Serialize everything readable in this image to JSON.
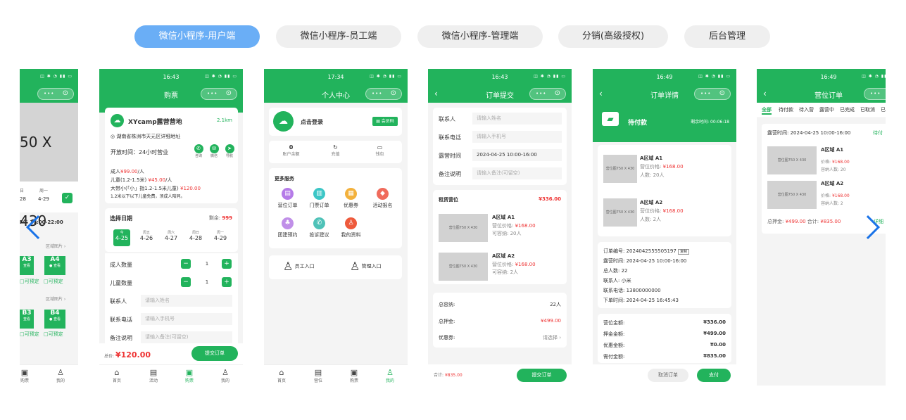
{
  "tabs": [
    "微信小程序-用户端",
    "微信小程序-员工端",
    "微信小程序-管理端",
    "分销(高级授权)",
    "后台管理"
  ],
  "status_icons": "◫ ✱ ◔ ▮▮ ▭",
  "p1": {
    "img": "50 X 430",
    "days": [
      {
        "w": "日",
        "d": "28"
      },
      {
        "w": "周一",
        "d": "4-29"
      }
    ],
    "hours": "F午 17:00-22:00",
    "region": "区域图片 ›",
    "zones": [
      {
        "n": "A3",
        "s": "查看",
        "a": "可预定"
      },
      {
        "n": "A4",
        "s": "● 查看",
        "a": "可预定"
      },
      {
        "n": "B3",
        "s": "查看",
        "a": "可预定"
      },
      {
        "n": "B4",
        "s": "● 查看",
        "a": "可预定"
      }
    ],
    "tabbar": [
      {
        "icon": "▣",
        "label": "购票"
      },
      {
        "icon": "♙",
        "label": "我的"
      }
    ]
  },
  "p2": {
    "title": "购票",
    "camp": "XYcamp露营营地",
    "dist": "2.1km",
    "addr": "◎ 湖南省株洲市天元区详细地址",
    "open": "开放时间：24小时营业",
    "actions": [
      {
        "icon": "✆",
        "label": "咨询"
      },
      {
        "icon": "✉",
        "label": "微信"
      },
      {
        "icon": "➤",
        "label": "导航"
      }
    ],
    "p_adult": "成人",
    "p_adult_price": "¥99.00",
    "p_adult_unit": "/人",
    "p_child": "儿童(1.2-1.5米) ",
    "p_child_price": "¥45.00",
    "p_child_unit": "/人",
    "p_family": "大带小(「小」指1.2-1.5米儿童) ",
    "p_family_price": "¥120.00",
    "p_note": "1.2米以下以下儿童免费，须成人陪同。",
    "date_title": "选择日期",
    "remain_label": "剩余: ",
    "remain": "999",
    "dates": [
      {
        "w": "今",
        "d": "4-25"
      },
      {
        "w": "周五",
        "d": "4-26"
      },
      {
        "w": "周六",
        "d": "4-27"
      },
      {
        "w": "周日",
        "d": "4-28"
      },
      {
        "w": "周一",
        "d": "4-29"
      }
    ],
    "adult_label": "成人数量",
    "child_label": "儿童数量",
    "qty": "1",
    "minus": "−",
    "plus": "+",
    "contact_label": "联系人",
    "contact_ph": "请输入姓名",
    "phone_label": "联系电话",
    "phone_ph": "请输入手机号",
    "remark_label": "备注说明",
    "remark_ph": "请输入备注(可留空)",
    "total_label": "总价: ",
    "total": "¥120.00",
    "submit": "提交订单",
    "tabbar": [
      {
        "icon": "⌂",
        "label": "首页"
      },
      {
        "icon": "▤",
        "label": "活动"
      },
      {
        "icon": "▣",
        "label": "购票"
      },
      {
        "icon": "♙",
        "label": "我的"
      }
    ]
  },
  "p3": {
    "time": "17:34",
    "title": "个人中心",
    "login": "点击登录",
    "member": "▤ 会员码",
    "stats": [
      {
        "v": "0",
        "l": "账户余额"
      },
      {
        "v": "↻",
        "l": "充值"
      },
      {
        "v": "▭",
        "l": "钱包"
      }
    ],
    "more": "更多服务",
    "services": [
      {
        "icon": "▤",
        "label": "营位订单",
        "c": "#b57be8"
      },
      {
        "icon": "▥",
        "label": "门票订单",
        "c": "#3cc6c6"
      },
      {
        "icon": "▦",
        "label": "优惠券",
        "c": "#f3b13c"
      },
      {
        "icon": "◆",
        "label": "活动报名",
        "c": "#f06b5c"
      },
      {
        "icon": "♣",
        "label": "团建预约",
        "c": "#c08fe8"
      },
      {
        "icon": "✆",
        "label": "投诉建议",
        "c": "#4fc2b8"
      },
      {
        "icon": "♙",
        "label": "我的资料",
        "c": "#ee5a3c"
      }
    ],
    "staff": "员工入口",
    "admin": "管理入口",
    "tabbar": [
      {
        "icon": "⌂",
        "label": "首页"
      },
      {
        "icon": "▤",
        "label": "营位"
      },
      {
        "icon": "▣",
        "label": "购票"
      },
      {
        "icon": "♙",
        "label": "我的"
      }
    ]
  },
  "p4": {
    "title": "订单提交",
    "fields": [
      {
        "l": "联系人",
        "v": "请输入姓名"
      },
      {
        "l": "联系电话",
        "v": "请输入手机号"
      },
      {
        "l": "露营时间",
        "v": "2024-04-25 10:00-16:00"
      },
      {
        "l": "备注说明",
        "v": "请输入备注(可留空)"
      }
    ],
    "rent": "租赁营位",
    "rent_total": "¥336.00",
    "items": [
      {
        "img": "营位图750 X 430",
        "name": "A区域 A1",
        "price_l": "营位价格: ",
        "price": "¥168.00",
        "cap": "可容纳: 20人"
      },
      {
        "img": "营位图750 X 430",
        "name": "A区域 A2",
        "price_l": "营位价格: ",
        "price": "¥168.00",
        "cap": "可容纳: 2人"
      }
    ],
    "sum": [
      {
        "l": "总容纳:",
        "v": "22人"
      },
      {
        "l": "总押金:",
        "v": "¥499.00"
      },
      {
        "l": "优惠券:",
        "v": "请选择 ›"
      }
    ],
    "total_label": "合计: ",
    "total": "¥835.00",
    "submit": "提交订单"
  },
  "p5": {
    "time": "16:49",
    "title": "订单详情",
    "status": "待付款",
    "remain": "剩余时间: 00:06:18",
    "items": [
      {
        "img": "营位图750 X 430",
        "name": "A区域 A1",
        "price_l": "营位价格: ",
        "price": "¥168.00",
        "ppl": "人数: 20人"
      },
      {
        "img": "营位图750 X 430",
        "name": "A区域 A2",
        "price_l": "营位价格: ",
        "price": "¥168.00",
        "ppl": "人数: 2人"
      }
    ],
    "order_no": "订单编号: 2024042555505197",
    "copy": "复制",
    "info": [
      "露营时间: 2024-04-25 10:00-16:00",
      "总人数: 22",
      "联系人: 小米",
      "联系电话: 13800000000",
      "下单时间: 2024-04-25 16:45:43"
    ],
    "amounts": [
      {
        "l": "营位金额:",
        "v": "¥336.00"
      },
      {
        "l": "押金金额:",
        "v": "¥499.00"
      },
      {
        "l": "优惠金额:",
        "v": "¥0.00"
      },
      {
        "l": "需付金额:",
        "v": "¥835.00"
      }
    ],
    "cancel": "取消订单",
    "pay": "支付"
  },
  "p6": {
    "time": "16:49",
    "title": "营位订单",
    "tabs": [
      "全部",
      "待付款",
      "待入营",
      "露营中",
      "已完成",
      "已取消",
      "已"
    ],
    "camp_time": "露营时间: 2024-04-25 10:00-16:00",
    "status": "待付",
    "items": [
      {
        "img": "营位图750 X 430",
        "name": "A区域 A1",
        "price_l": "价格: ",
        "price": "¥168.00",
        "cap": "容纳人数: 20"
      },
      {
        "img": "营位图750 X 430",
        "name": "A区域 A2",
        "price_l": "价格: ",
        "price": "¥168.00",
        "cap": "容纳人数: 2"
      }
    ],
    "deposit_l": "总押金: ",
    "deposit": "¥499.00",
    "total_l": " 合计: ",
    "total": "¥835.00",
    "detail": "详细"
  },
  "times": {
    "p1": "",
    "p2": "16:43",
    "p4": "16:43"
  }
}
